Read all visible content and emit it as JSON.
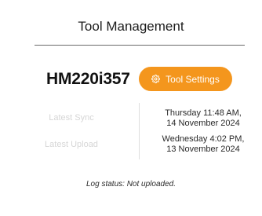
{
  "header": {
    "title": "Tool Management"
  },
  "tool": {
    "id": "HM220i357",
    "settings_label": "Tool Settings",
    "settings_icon": "gear-icon"
  },
  "sync": {
    "label": "Latest Sync",
    "value_line1": "Thursday 11:48 AM,",
    "value_line2": "14 November 2024"
  },
  "upload": {
    "label": "Latest Upload",
    "value_line1": "Wednesday 4:02 PM,",
    "value_line2": "13 November 2024"
  },
  "log": {
    "status_text": "Log status: Not uploaded."
  },
  "colors": {
    "accent": "#f4961d",
    "muted_label": "#d6d6d6",
    "text": "#2a2a2a"
  }
}
